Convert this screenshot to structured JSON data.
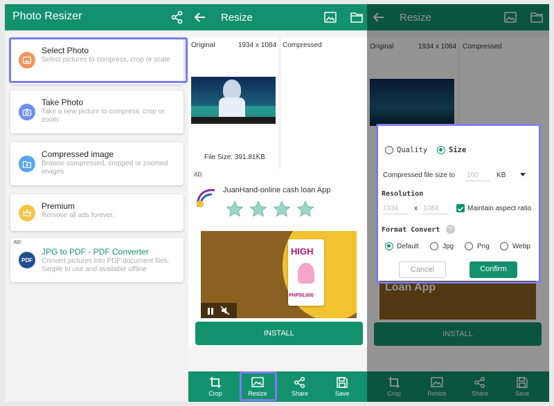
{
  "colors": {
    "accent": "#13916d",
    "highlight": "#7c7cf0"
  },
  "left": {
    "title": "Photo Resizer",
    "items": [
      {
        "title": "Select Photo",
        "sub": "Select pictures to compress, crop or scale",
        "icon": "image-icon",
        "color": "#f0955a"
      },
      {
        "title": "Take Photo",
        "sub": "Take a new picture to compress, crop or zoom",
        "icon": "camera-icon",
        "color": "#6e8ef0"
      },
      {
        "title": "Compressed image",
        "sub": "Browse compressed, cropped or zoomed images",
        "icon": "folder-plus-icon",
        "color": "#5aa4ef"
      },
      {
        "title": "Premium",
        "sub": "Remove all ads forever.",
        "icon": "crown-icon",
        "color": "#f6c347"
      },
      {
        "title": "JPG to PDF - PDF Converter",
        "sub": "Convert pictures into PDF document files. Simple to use and available offline",
        "icon": "pdf-icon",
        "color": "#1f4f8f"
      }
    ],
    "ad_label": "AD",
    "pdf_badge": "PDF"
  },
  "resize": {
    "title": "Resize",
    "original_label": "Original",
    "dimensions": "1934 x 1084",
    "compressed_label": "Compressed",
    "file_size": "File Size: 391.81KB",
    "ad_label": "AD",
    "ad_title": "JuanHand-online cash loan App",
    "ad_rating": 4,
    "ad_headline": "HIGH",
    "ad_amount": "PHP50,000",
    "install": "INSTALL",
    "toolbar": [
      {
        "label": "Crop",
        "icon": "crop-icon"
      },
      {
        "label": "Resize",
        "icon": "resize-image-icon"
      },
      {
        "label": "Share",
        "icon": "share-icon"
      },
      {
        "label": "Save",
        "icon": "save-icon"
      }
    ]
  },
  "dialog": {
    "bg_ad_text": "Loan App",
    "quality": "Quality",
    "size": "Size",
    "compressed_size_label": "Compressed file size to",
    "size_placeholder": "100",
    "unit": "KB",
    "resolution": "Resolution",
    "width": "1934",
    "x": "x",
    "height": "1084",
    "aspect": "Maintain aspect ratio",
    "format_convert": "Format Convert",
    "formats": [
      "Default",
      "Jpg",
      "Png",
      "Webp"
    ],
    "help": "?",
    "cancel": "Cancel",
    "confirm": "Confirm"
  }
}
